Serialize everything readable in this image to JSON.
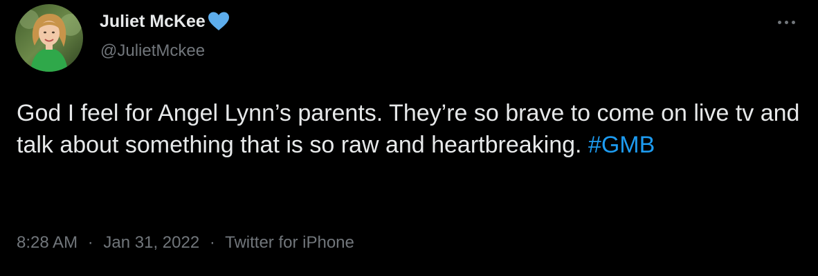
{
  "author": {
    "display_name": "Juliet McKee",
    "handle": "@JulietMckee",
    "name_emoji": "blue-heart-icon"
  },
  "tweet": {
    "text_before_hashtag": "God I feel for Angel Lynn’s parents. They’re so brave to come on live tv and talk about something that is so raw and heartbreaking. ",
    "hashtag": "#GMB"
  },
  "meta": {
    "time": "8:28 AM",
    "separator": "·",
    "date": "Jan 31, 2022",
    "source": "Twitter for iPhone"
  },
  "colors": {
    "background": "#000000",
    "text_primary": "#e7e9ea",
    "text_secondary": "#71767b",
    "link_blue": "#1d9bf0",
    "heart_blue": "#5dadec"
  },
  "icons": {
    "more": "more-horizontal-icon"
  }
}
